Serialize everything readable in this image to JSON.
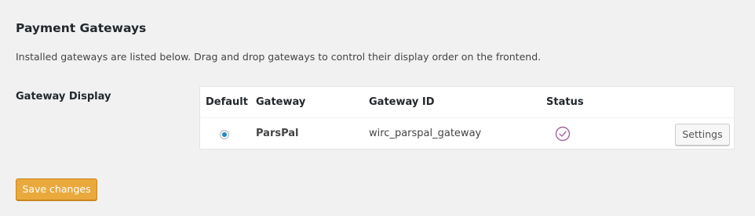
{
  "section": {
    "title": "Payment Gateways",
    "description": "Installed gateways are listed below. Drag and drop gateways to control their display order on the frontend."
  },
  "gateway_display": {
    "label": "Gateway Display",
    "columns": {
      "default": "Default",
      "gateway": "Gateway",
      "gateway_id": "Gateway ID",
      "status": "Status"
    },
    "rows": [
      {
        "default_selected": true,
        "gateway": "ParsPal",
        "gateway_id": "wirc_parspal_gateway",
        "status_icon": "check-circle-icon",
        "settings_label": "Settings"
      }
    ]
  },
  "footer": {
    "save_label": "Save changes"
  },
  "colors": {
    "accent_radio": "#1e8cbe",
    "status_check": "#a46497",
    "save_button": "#e9a93d"
  }
}
